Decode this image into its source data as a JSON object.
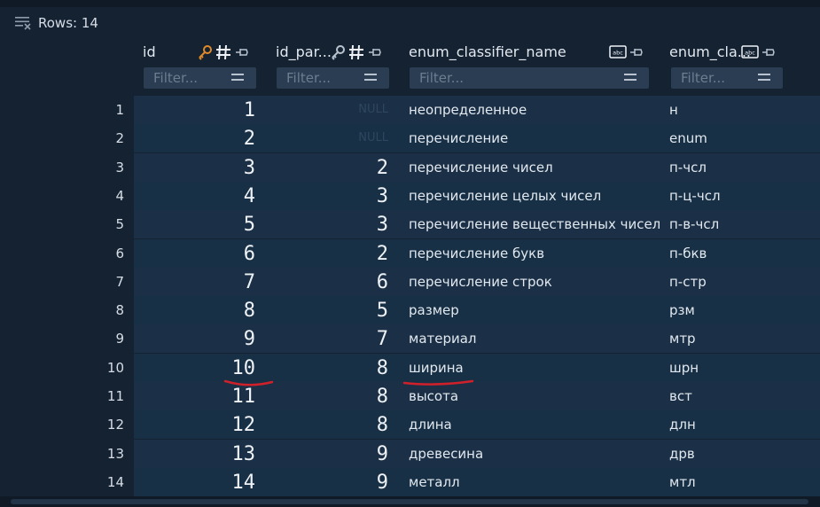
{
  "toolbar": {
    "rows_label": "Rows: 14"
  },
  "columns": [
    {
      "name": "id",
      "icons": [
        "key-icon",
        "numeric-icon",
        "pin-icon"
      ],
      "filter_placeholder": "Filter..."
    },
    {
      "name": "id_par...",
      "icons": [
        "key-icon",
        "numeric-icon",
        "pin-icon"
      ],
      "filter_placeholder": "Filter..."
    },
    {
      "name": "enum_classifier_name",
      "icons": [
        "text-type-icon",
        "pin-icon"
      ],
      "filter_placeholder": "Filter..."
    },
    {
      "name": "enum_cla...",
      "icons": [
        "text-type-icon",
        "pin-icon"
      ],
      "filter_placeholder": "Filter..."
    }
  ],
  "rows": [
    {
      "n": "1",
      "id": "1",
      "parent": "NULL",
      "name": "неопределенное",
      "code": "н"
    },
    {
      "n": "2",
      "id": "2",
      "parent": "NULL",
      "name": "перечисление",
      "code": "enum"
    },
    {
      "n": "3",
      "id": "3",
      "parent": "2",
      "name": "перечисление чисел",
      "code": "п-чсл"
    },
    {
      "n": "4",
      "id": "4",
      "parent": "3",
      "name": "перечисление целых чисел",
      "code": "п-ц-чсл"
    },
    {
      "n": "5",
      "id": "5",
      "parent": "3",
      "name": "перечисление вещественных чисел",
      "code": "п-в-чсл"
    },
    {
      "n": "6",
      "id": "6",
      "parent": "2",
      "name": "перечисление букв",
      "code": "п-бкв"
    },
    {
      "n": "7",
      "id": "7",
      "parent": "6",
      "name": "перечисление строк",
      "code": "п-стр"
    },
    {
      "n": "8",
      "id": "8",
      "parent": "5",
      "name": "размер",
      "code": "рзм"
    },
    {
      "n": "9",
      "id": "9",
      "parent": "7",
      "name": "материал",
      "code": "мтр"
    },
    {
      "n": "10",
      "id": "10",
      "parent": "8",
      "name": "ширина",
      "code": "шрн"
    },
    {
      "n": "11",
      "id": "11",
      "parent": "8",
      "name": "высота",
      "code": "вст"
    },
    {
      "n": "12",
      "id": "12",
      "parent": "8",
      "name": "длина",
      "code": "длн"
    },
    {
      "n": "13",
      "id": "13",
      "parent": "9",
      "name": "древесина",
      "code": "дрв"
    },
    {
      "n": "14",
      "id": "14",
      "parent": "9",
      "name": "металл",
      "code": "мтл"
    }
  ],
  "colors": {
    "background": "#142232",
    "row_even": "#1b3046",
    "row_odd": "#183045",
    "key_icon_primary": "#e08a2a",
    "annotation": "#d0202a"
  }
}
